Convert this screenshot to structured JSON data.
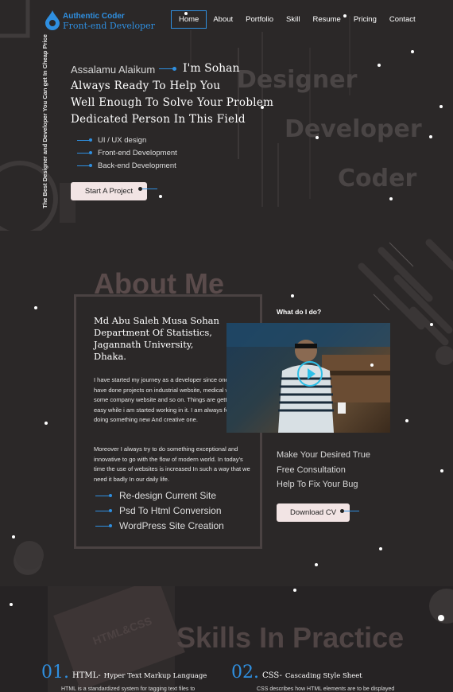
{
  "brand": {
    "title": "Authentic Coder",
    "subtitle": "Front-end Developer"
  },
  "nav": [
    "Home",
    "About",
    "Portfolio",
    "Skill",
    "Resume",
    "Pricing",
    "Contact"
  ],
  "hero": {
    "vertical_tagline": "The Best Designer and Developer You Can get In Cheap Price",
    "greeting": "Assalamu Alaikum",
    "name": "I'm Sohan",
    "lines": [
      "Always Ready To Help You",
      "Well Enough To Solve Your Problem",
      "Dedicated Person In This Field"
    ],
    "skills": [
      "UI / UX design",
      "Front-end Development",
      "Back-end Development"
    ],
    "cta": "Start A Project",
    "bg_words": [
      "Designer",
      "Developer",
      "Coder"
    ]
  },
  "about": {
    "title": "About Me",
    "name_block": [
      "Md Abu Saleh Musa Sohan",
      "Department Of Statistics,",
      "Jagannath University,",
      "Dhaka."
    ],
    "para1": "I have started my journey as a developer since one year. I have done projects on industrial website, medical website, some company website and so on. Things are getting too easy while i am started working in it. I am always fond of doing something new And creative one.",
    "para2": "Moreover I always try to do something exceptional and innovative to go with the flow of modern world. In today's time the use of websites is increased In such a way that we need it badly In our daily life.",
    "services": [
      "Re-design Current Site",
      "Psd To Html Conversion",
      "WordPress Site Creation"
    ],
    "what_heading": "What do I do?",
    "offers": [
      "Make Your Desired True",
      "Free Consultation",
      "Help To Fix Your Bug"
    ],
    "download": "Download CV",
    "laptop_text": "HTML&CSS"
  },
  "skills": {
    "title": "Skills In Practice",
    "items": [
      {
        "num": "01.",
        "name": "HTML-",
        "full": "Hyper Text Markup Language",
        "desc": "HTML is a standardized system for tagging text files to"
      },
      {
        "num": "02.",
        "name": "CSS-",
        "full": "Cascading Style Sheet",
        "desc": "CSS describes how HTML elements are to be displayed"
      }
    ]
  },
  "colors": {
    "accent": "#2f8fe0",
    "background": "#2b2828",
    "button": "#f2e4e4"
  }
}
